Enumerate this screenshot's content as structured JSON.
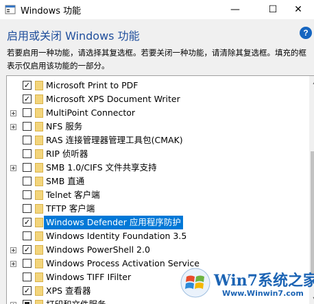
{
  "window": {
    "title": "Windows 功能",
    "minimize_glyph": "—",
    "maximize_glyph": "☐",
    "close_glyph": "✕"
  },
  "header": {
    "heading": "启用或关闭 Windows 功能",
    "help_glyph": "?",
    "description": "若要启用一种功能，请选择其复选框。若要关闭一种功能，请清除其复选框。填充的框表示仅启用该功能的一部分。"
  },
  "features": [
    {
      "label": "Microsoft Print to PDF",
      "state": "checked",
      "expandable": false,
      "selected": false
    },
    {
      "label": "Microsoft XPS Document Writer",
      "state": "checked",
      "expandable": false,
      "selected": false
    },
    {
      "label": "MultiPoint Connector",
      "state": "unchecked",
      "expandable": true,
      "selected": false
    },
    {
      "label": "NFS 服务",
      "state": "unchecked",
      "expandable": true,
      "selected": false
    },
    {
      "label": "RAS 连接管理器管理工具包(CMAK)",
      "state": "unchecked",
      "expandable": false,
      "selected": false
    },
    {
      "label": "RIP 侦听器",
      "state": "unchecked",
      "expandable": false,
      "selected": false
    },
    {
      "label": "SMB 1.0/CIFS 文件共享支持",
      "state": "unchecked",
      "expandable": true,
      "selected": false
    },
    {
      "label": "SMB 直通",
      "state": "unchecked",
      "expandable": false,
      "selected": false
    },
    {
      "label": "Telnet 客户端",
      "state": "unchecked",
      "expandable": false,
      "selected": false
    },
    {
      "label": "TFTP 客户端",
      "state": "unchecked",
      "expandable": false,
      "selected": false
    },
    {
      "label": "Windows Defender 应用程序防护",
      "state": "checked",
      "expandable": false,
      "selected": true
    },
    {
      "label": "Windows Identity Foundation 3.5",
      "state": "unchecked",
      "expandable": false,
      "selected": false
    },
    {
      "label": "Windows PowerShell 2.0",
      "state": "checked",
      "expandable": true,
      "selected": false
    },
    {
      "label": "Windows Process Activation Service",
      "state": "unchecked",
      "expandable": true,
      "selected": false
    },
    {
      "label": "Windows TIFF IFilter",
      "state": "unchecked",
      "expandable": false,
      "selected": false
    },
    {
      "label": "XPS 查看器",
      "state": "checked",
      "expandable": false,
      "selected": false
    },
    {
      "label": "打印和文件服务",
      "state": "partial",
      "expandable": true,
      "selected": false
    }
  ],
  "scrollbar": {
    "up_glyph": "▲",
    "down_glyph": "▼"
  },
  "watermark": {
    "brand": "Win7系统之家",
    "url": "Www.Winwin7.com"
  },
  "colors": {
    "heading": "#1f4e9c",
    "selection": "#0078d7",
    "help": "#1565c0",
    "watermark": "#1c64b4"
  }
}
